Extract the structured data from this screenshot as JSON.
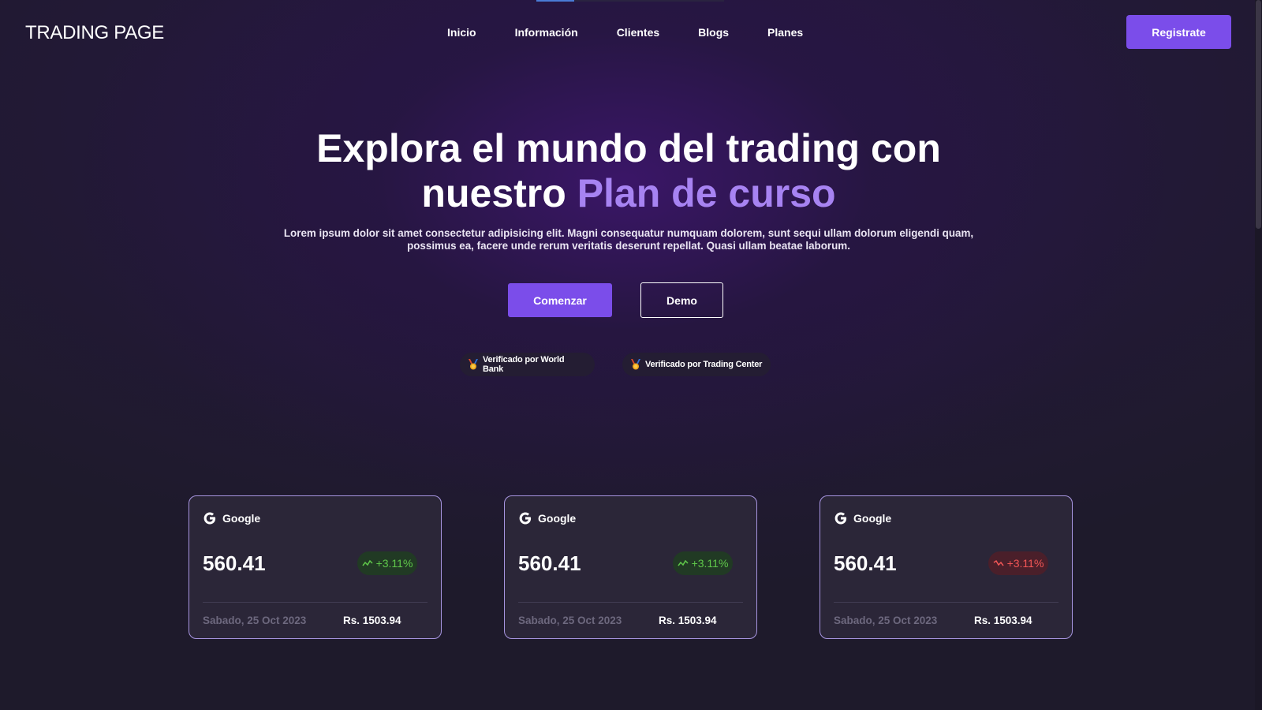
{
  "brand": {
    "name": "TRADING PAGE"
  },
  "nav": {
    "items": [
      {
        "label": "Inicio"
      },
      {
        "label": "Información"
      },
      {
        "label": "Clientes"
      },
      {
        "label": "Blogs"
      },
      {
        "label": "Planes"
      }
    ],
    "register_label": "Registrate"
  },
  "hero": {
    "title_line1": "Explora el mundo del trading con",
    "title_line2_prefix": "nuestro",
    "title_line2_accent": "Plan de curso",
    "subtitle": "Lorem ipsum dolor sit amet consectetur adipisicing elit. Magni consequatur numquam dolorem, sunt sequi ullam dolorum eligendi quam, possimus ea, facere unde rerum veritatis deserunt repellat. Quasi ullam beatae laborum.",
    "start_label": "Comenzar",
    "demo_label": "Demo",
    "badges": [
      {
        "label": "Verificado por World Bank"
      },
      {
        "label": "Verificado por Trading Center"
      }
    ]
  },
  "cards": [
    {
      "company": "Google",
      "price": "560.41",
      "change": "+3.11%",
      "trend": "up",
      "date": "Sabado, 25 Oct 2023",
      "amount": "Rs. 1503.94"
    },
    {
      "company": "Google",
      "price": "560.41",
      "change": "+3.11%",
      "trend": "up",
      "date": "Sabado, 25 Oct 2023",
      "amount": "Rs. 1503.94"
    },
    {
      "company": "Google",
      "price": "560.41",
      "change": "+3.11%",
      "trend": "down",
      "date": "Sabado, 25 Oct 2023",
      "amount": "Rs. 1503.94"
    }
  ],
  "colors": {
    "background": "#1e1a2b",
    "accent": "#7b4dea",
    "accent_text": "#a783f2",
    "positive": "#5fc74a",
    "negative": "#f25656"
  },
  "icons": {
    "badge": "medal-icon",
    "company": "google-icon",
    "trend": "trend-icon"
  }
}
